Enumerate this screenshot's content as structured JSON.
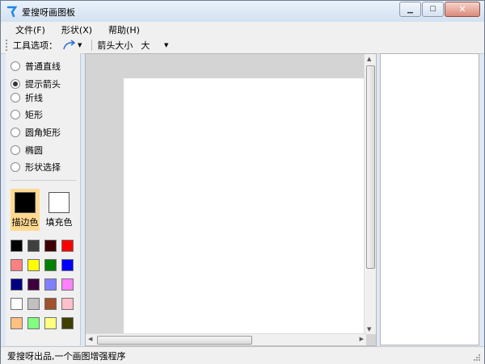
{
  "window": {
    "title": "爱搜呀画图板"
  },
  "menubar": {
    "items": [
      "文件(F)",
      "形状(X)",
      "帮助(H)"
    ]
  },
  "toolbar": {
    "tool_options_label": "工具选项：",
    "arrow_size_label": "箭头大小",
    "arrow_size_value": "大"
  },
  "shapes": {
    "options": [
      "普通直线",
      "提示箭头",
      "折线",
      "矩形",
      "圆角矩形",
      "椭圆",
      "形状选择"
    ],
    "selected_index": 1
  },
  "colors": {
    "stroke_label": "描边色",
    "fill_label": "填充色",
    "stroke_color": "#000000",
    "fill_color": "#ffffff",
    "palette": [
      "#000000",
      "#404040",
      "#400000",
      "#ff0000",
      "#ff8080",
      "#ffff00",
      "#008000",
      "#0000ff",
      "#000080",
      "#400040",
      "#8080ff",
      "#ff80ff",
      "#ffffff",
      "#c0c0c0",
      "#a0522d",
      "#ffc0cb",
      "#ffc080",
      "#80ff80",
      "#ffff80",
      "#404000"
    ]
  },
  "status": {
    "text": "爱搜呀出品,一个画图增强程序"
  }
}
